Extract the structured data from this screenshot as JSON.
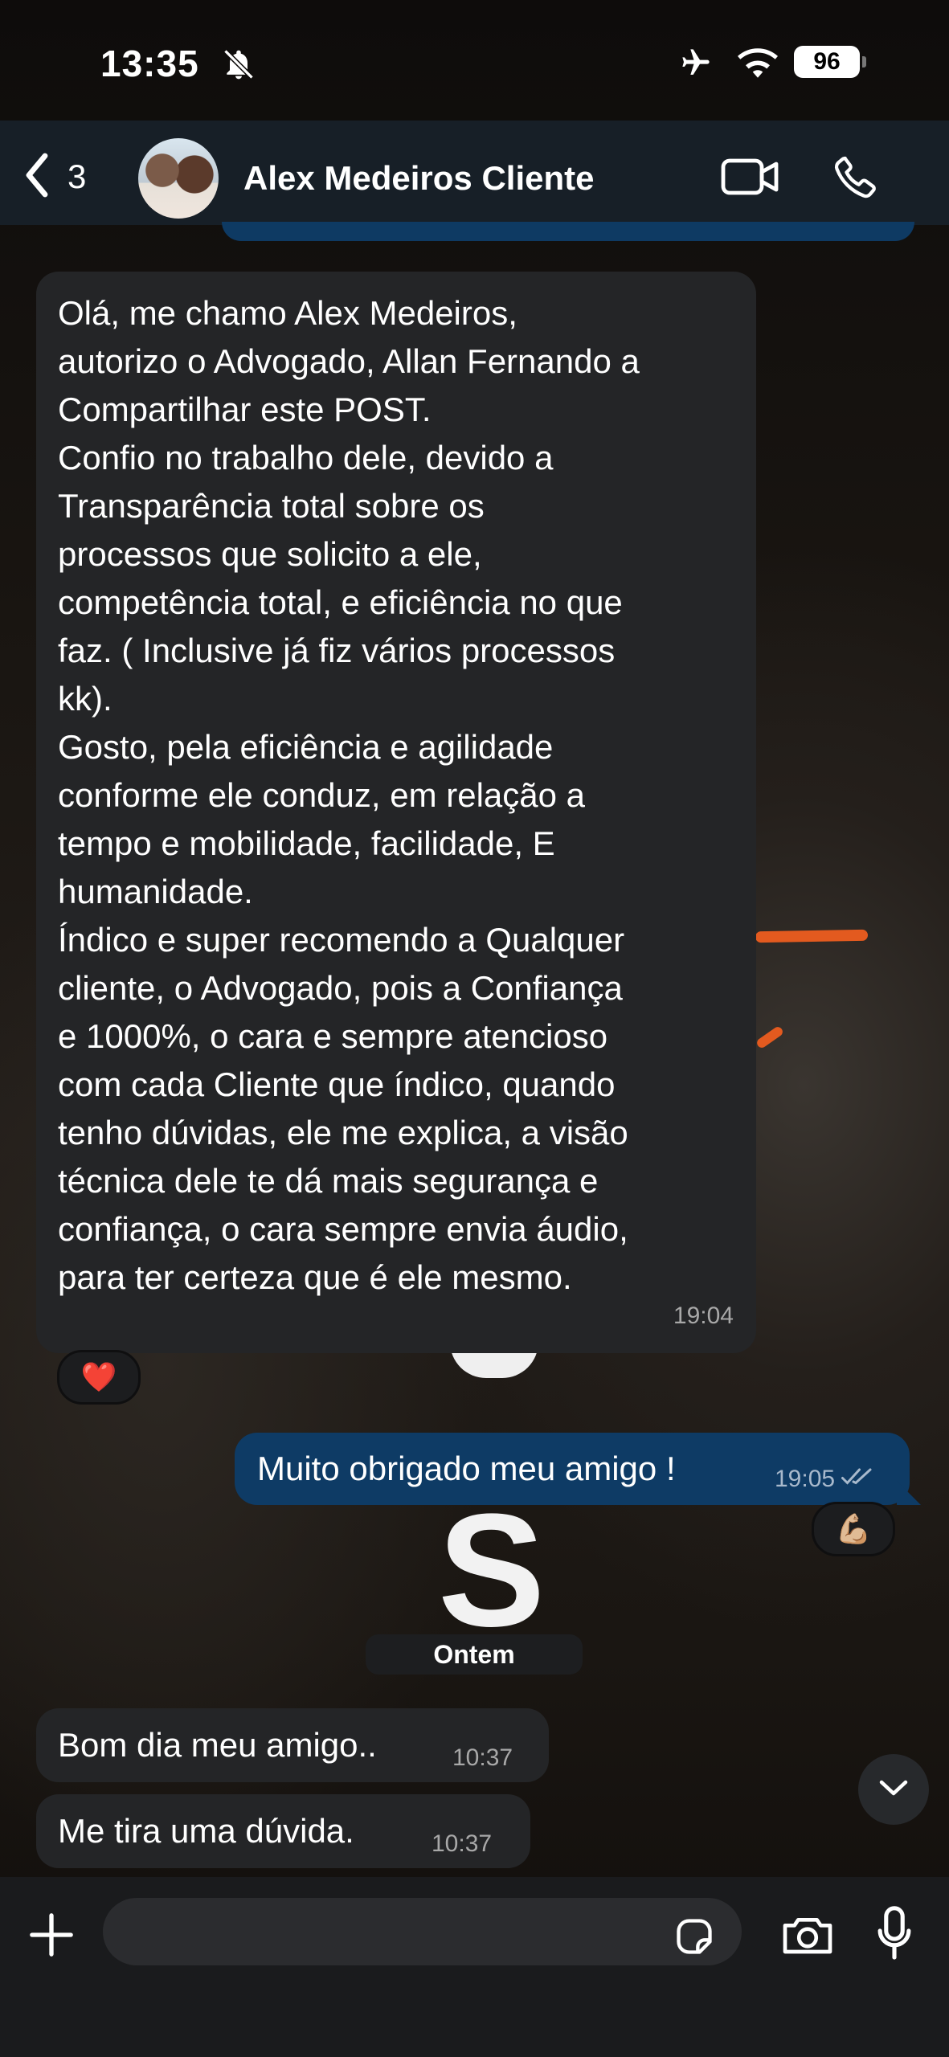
{
  "status_bar": {
    "time": "13:35",
    "battery": "96"
  },
  "header": {
    "back_count": "3",
    "contact_name": "Alex Medeiros Cliente"
  },
  "messages": [
    {
      "direction": "incoming",
      "text": "Olá, me chamo Alex Medeiros,\nautorizo o Advogado, Allan Fernando a\nCompartilhar este POST.\nConfio no trabalho dele, devido a\nTransparência total sobre os\nprocessos que solicito a ele,\ncompetência total, e eficiência no que\nfaz. ( Inclusive já fiz vários processos\nkk).\nGosto, pela eficiência e agilidade\nconforme ele conduz, em relação a\ntempo e mobilidade, facilidade, E\nhumanidade.\nÍndico e super recomendo a Qualquer\ncliente, o Advogado, pois a Confiança\ne 1000%, o cara e sempre atencioso\ncom cada Cliente que índico, quando\ntenho dúvidas, ele me explica, a visão\ntécnica dele te dá mais segurança e\nconfiança, o cara sempre envia áudio,\npara ter certeza que é ele mesmo.",
      "time": "19:04",
      "reaction": "❤️"
    },
    {
      "direction": "outgoing",
      "text": "Muito obrigado meu amigo !",
      "time": "19:05",
      "reaction": "💪🏼"
    },
    {
      "direction": "incoming",
      "text": "Bom dia meu amigo..",
      "time": "10:37"
    },
    {
      "direction": "incoming",
      "text": "Me tira uma dúvida.",
      "time": "10:37"
    }
  ],
  "date_separator": "Ontem",
  "composer": {
    "placeholder": ""
  },
  "colors": {
    "header_bg": "#18202a",
    "incoming_bubble": "#242527",
    "outgoing_bubble": "#0e3b65",
    "wallpaper_accent": "#e35a1f"
  },
  "icons": [
    "bell-slash-icon",
    "airplane-icon",
    "wifi-icon",
    "chevron-left-icon",
    "video-camera-icon",
    "phone-icon",
    "chevron-down-icon",
    "plus-icon",
    "sticker-icon",
    "camera-icon",
    "microphone-icon",
    "double-check-icon"
  ]
}
